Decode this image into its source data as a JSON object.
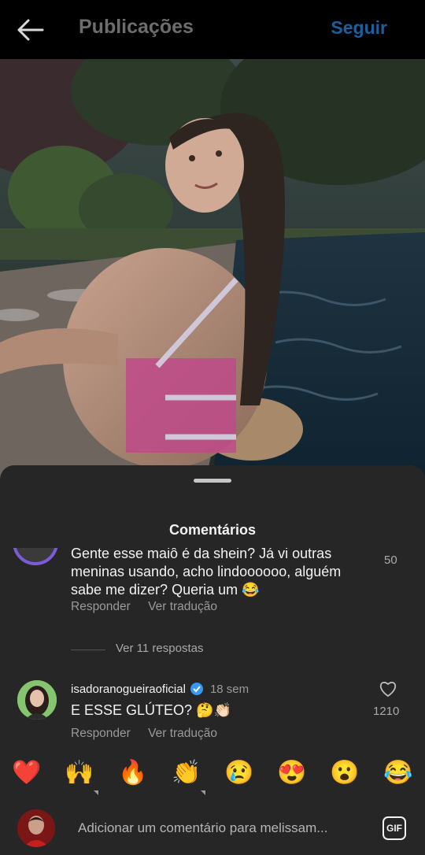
{
  "header": {
    "title": "Publicações",
    "follow_label": "Seguir"
  },
  "sheet": {
    "title": "Comentários"
  },
  "comments": [
    {
      "text": "Gente esse maiô é da shein? Já vi outras meninas usando, acho lindoooooo, alguém sabe me dizer? Queria um 😂",
      "likes": "50",
      "reply_label": "Responder",
      "translate_label": "Ver tradução",
      "view_replies": "Ver 11 respostas"
    },
    {
      "username": "isadoranogueiraoficial",
      "time": "18 sem",
      "text": "E ESSE GLÚTEO? 🤔👏🏻",
      "likes": "1210",
      "reply_label": "Responder",
      "translate_label": "Ver tradução"
    }
  ],
  "emoji_bar": [
    "❤️",
    "🙌",
    "🔥",
    "👏",
    "😢",
    "😍",
    "😮",
    "😂"
  ],
  "input": {
    "placeholder": "Adicionar um comentário para melissam...",
    "gif_label": "GIF"
  },
  "colors": {
    "background": "#000000",
    "sheet": "#262626",
    "follow": "#1d5f9c",
    "verified": "#3897f0"
  }
}
